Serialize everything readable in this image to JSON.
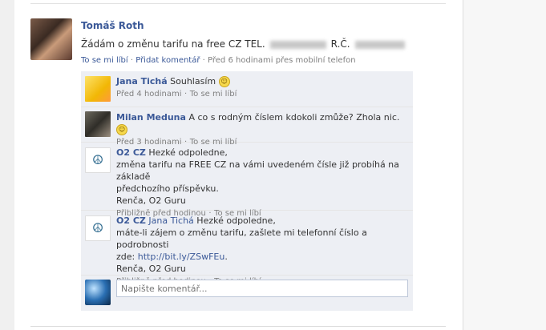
{
  "post": {
    "author": "Tomáš Roth",
    "text_prefix": "Žádám o změnu tarifu na free CZ TEL.",
    "text_middle": "R.Č.",
    "meta_like": "To se mi líbí",
    "meta_comment": "Přidat komentář",
    "meta_time": "Před 6 hodinami přes mobilní telefon"
  },
  "comments": [
    {
      "author": "Jana Tichá",
      "text": "Souhlasím",
      "time": "Před 4 hodinami",
      "like": "To se mi líbí",
      "has_smiley": true
    },
    {
      "author": "Milan Meduna",
      "text": "A co s rodným číslem kdokoli zmůže? Zhola nic.",
      "time": "Před 3 hodinami",
      "like": "To se mi líbí",
      "has_smiley": true
    },
    {
      "author": "O2 CZ",
      "lines": [
        "Hezké odpoledne,",
        "změna tarifu na FREE CZ na vámi uvedeném čísle již probíhá na základě",
        "předchozího příspěvku.",
        "Renča, O2 Guru"
      ],
      "time": "Přibližně před hodinou",
      "like": "To se mi líbí"
    },
    {
      "author": "O2 CZ",
      "mention": "Jana Tichá",
      "lines": [
        "Hezké odpoledne,",
        "máte-li zájem o změnu tarifu, zašlete mi telefonní číslo a podrobnosti",
        "zde:",
        "Renča, O2 Guru"
      ],
      "url": "http://bit.ly/ZSwFEu",
      "time": "Přibližně před hodinou",
      "like": "To se mi líbí"
    }
  ],
  "composer": {
    "placeholder": "Napište komentář..."
  },
  "sep": "·",
  "smiley_glyph": "☺",
  "peace_glyph": "☮"
}
